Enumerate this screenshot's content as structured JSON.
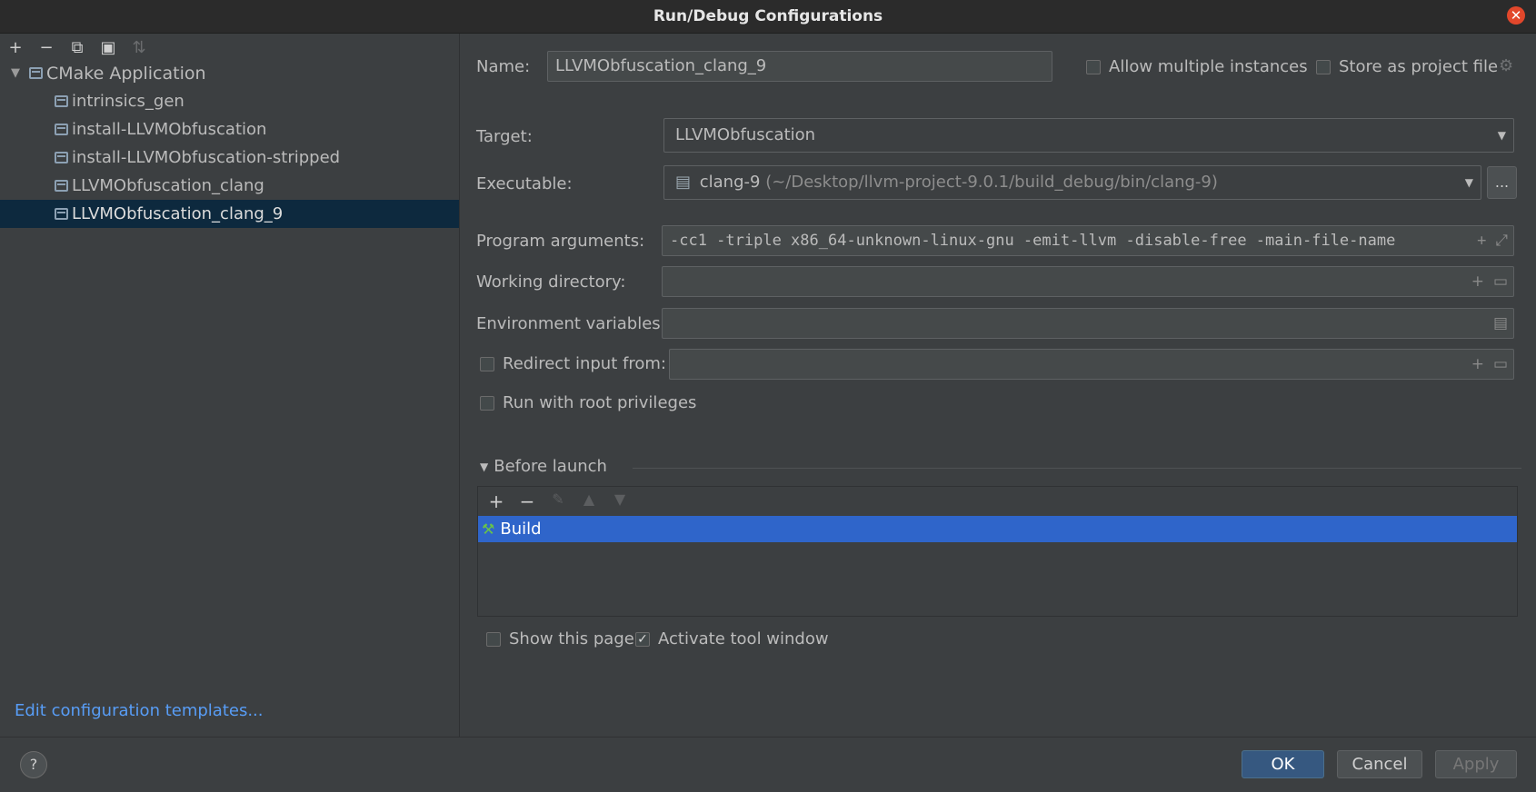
{
  "window": {
    "title": "Run/Debug Configurations"
  },
  "left_toolbar": {
    "add": "+",
    "remove": "−",
    "copy": "⧉",
    "folder": "▣",
    "sort": "⇅"
  },
  "tree": {
    "group": "CMake Application",
    "items": [
      {
        "label": "intrinsics_gen"
      },
      {
        "label": "install-LLVMObfuscation"
      },
      {
        "label": "install-LLVMObfuscation-stripped"
      },
      {
        "label": "LLVMObfuscation_clang"
      },
      {
        "label": "LLVMObfuscation_clang_9"
      }
    ]
  },
  "edit_templates": "Edit configuration templates...",
  "form": {
    "name_label": "Name:",
    "name_value": "LLVMObfuscation_clang_9",
    "allow_multiple": "Allow multiple instances",
    "store_project": "Store as project file",
    "target_label": "Target:",
    "target_value": "LLVMObfuscation",
    "executable_label": "Executable:",
    "executable_name": "clang-9",
    "executable_path": "(~/Desktop/llvm-project-9.0.1/build_debug/bin/clang-9)",
    "executable_more": "...",
    "args_label": "Program arguments:",
    "args_value": "-cc1 -triple x86_64-unknown-linux-gnu -emit-llvm -disable-free -main-file-name",
    "workdir_label": "Working directory:",
    "env_label": "Environment variables:",
    "redirect_label": "Redirect input from:",
    "root_label": "Run with root privileges"
  },
  "before_launch": {
    "title": "Before launch",
    "items": [
      {
        "label": "Build"
      }
    ],
    "show_page": "Show this page",
    "activate_tool": "Activate tool window",
    "activate_checked": true
  },
  "buttons": {
    "help": "?",
    "ok": "OK",
    "cancel": "Cancel",
    "apply": "Apply"
  },
  "colors": {
    "accent": "#2f65ca",
    "selection": "#0d293e",
    "link": "#589df6"
  }
}
